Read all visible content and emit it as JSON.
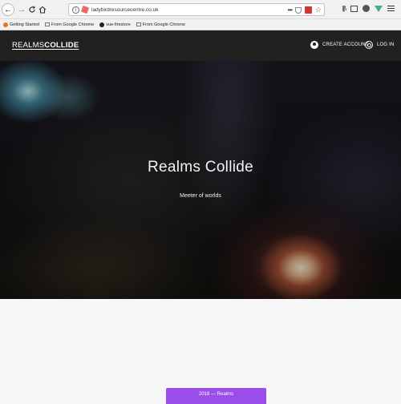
{
  "browser": {
    "url": "ladybirdresourcecentre.co.uk",
    "bookmarks": [
      {
        "label": "Getting Started",
        "icon": "firefox-icon"
      },
      {
        "label": "From Google Chrome",
        "icon": "folder-icon"
      },
      {
        "label": "vue-firestore",
        "icon": "github-icon"
      },
      {
        "label": "From Google Chrome",
        "icon": "folder-icon"
      }
    ]
  },
  "site": {
    "logo_light": "REALMS",
    "logo_bold": "COLLIDE",
    "nav": {
      "create_account": "CREATE ACCOUNT",
      "log_in": "LOG IN"
    },
    "hero": {
      "title": "Realms Collide",
      "subtitle": "Meeter of worlds"
    },
    "footer_button": "2018 — Realms"
  },
  "colors": {
    "header_bg": "#212121",
    "accent_purple": "#9b4dea",
    "page_bg": "#f7f7f7"
  }
}
